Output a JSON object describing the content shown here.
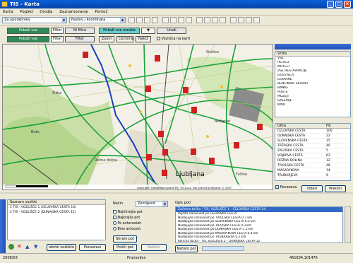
{
  "window": {
    "title": "TIS - Karta"
  },
  "menu": [
    "Karta",
    "Pogled",
    "Orodja",
    "Zaznamovanje",
    "Pomoč"
  ],
  "toolbar": {
    "combo1": "Za uporabnika",
    "combo2": "Naslov / koordinata"
  },
  "layers": {
    "row1": [
      "Pokaži vse",
      "Filter",
      "Ni filtra",
      "Prikaži vse oznake",
      "Uredi"
    ],
    "row2": [
      "Pokaži vse",
      "Filter",
      "Zoom",
      "Centriraj",
      "Nalož",
      "Vozlišča na karti"
    ]
  },
  "map": {
    "city": "Ljubljana",
    "copyright": "Copyright: Geodetska uprava RS, TIS d.o.o. Vse pravice pridržane. © 2007",
    "places": [
      "Šiška",
      "Brdo",
      "Rožna dolina",
      "Fužine",
      "Bežigrad",
      "Stožice"
    ]
  },
  "right_top": {
    "header": "Vrsta",
    "items": [
      "VSE",
      "HOTELI",
      "MOTELI",
      "VSE RESTAVRACIJE",
      "GOSTIŠČA",
      "LEKARNE",
      "BENCINSKI SERVISI",
      "BANKE",
      "POŠTE",
      "MUZEJI",
      "GALERIJE",
      "KINO"
    ]
  },
  "right_mid": {
    "headers": [
      "Ulica",
      "Hš"
    ],
    "rows": [
      [
        "CELOVŠKA CESTA",
        "100"
      ],
      [
        "DUNAJSKA CESTA",
        "22"
      ],
      [
        "SLOVENSKA CESTA",
        "15"
      ],
      [
        "TRŽAŠKA CESTA",
        "40"
      ],
      [
        "ZALOŠKA CESTA",
        "5"
      ],
      [
        "VOJKOVA CESTA",
        "63"
      ],
      [
        "ROŽNA DOLINA",
        "12"
      ],
      [
        "TIVOLSKA CESTA",
        "48"
      ],
      [
        "MASARYKOVA",
        "14"
      ],
      [
        "TRUBARJEVA",
        "9"
      ]
    ],
    "check": "Povezava",
    "btn1": "Izberi",
    "btn2": "Prekliči"
  },
  "bottom_left": {
    "header": "Seznam vozlišč",
    "rows": [
      "1  TIS - VOZLIŠČE 1 (CELOVŠKA CESTA 14)",
      "2  TIS - VOZLIŠČE 2 (DUNAJSKA CESTA 12)"
    ],
    "btn1": "Izbriši vozlišče",
    "btn2": "Ponastavi"
  },
  "bottom_mid": {
    "label": "Način",
    "combo": "Zemljevid",
    "options": [
      "Najhitrejša pot",
      "Najkrajša pot",
      "Po avtocestah",
      "Brez avtocest"
    ],
    "btn1": "Shrani pot",
    "btn2": "Poišči pot",
    "btn3": "Natisni"
  },
  "bottom_right": {
    "header": "Opis poti",
    "selected": "Začetna točka - TIS, VOZLIŠČE 1 - CELOVŠKA CESTA 14",
    "rows": [
      "Pojdite naravnost po CELOVŠKA CESTA",
      "Nadaljujte naravnost po TIVOLSKA CESTA 0.7 km",
      "Nadaljujte naravnost po SLOVENSKA CESTA 0.5 km",
      "Nadaljujte naravnost po TRŽAŠKA CESTA 0.3 km",
      "Nadaljujte naravnost po DUNAJSKA CESTA 1.1 km",
      "Nadaljujte naravnost po MASARYKOVA CESTA 0.4 km",
      "Nadaljujte naravnost po TRUBARJEVA 0.2 km",
      "Končna točka - TIS, VOZLIŠČE 2 - DUNAJSKA CESTA 12"
    ],
    "btn": "Natisni pot"
  },
  "status": {
    "left": "2008/03",
    "mid": "Pripravljen",
    "right": "461834,101476"
  }
}
